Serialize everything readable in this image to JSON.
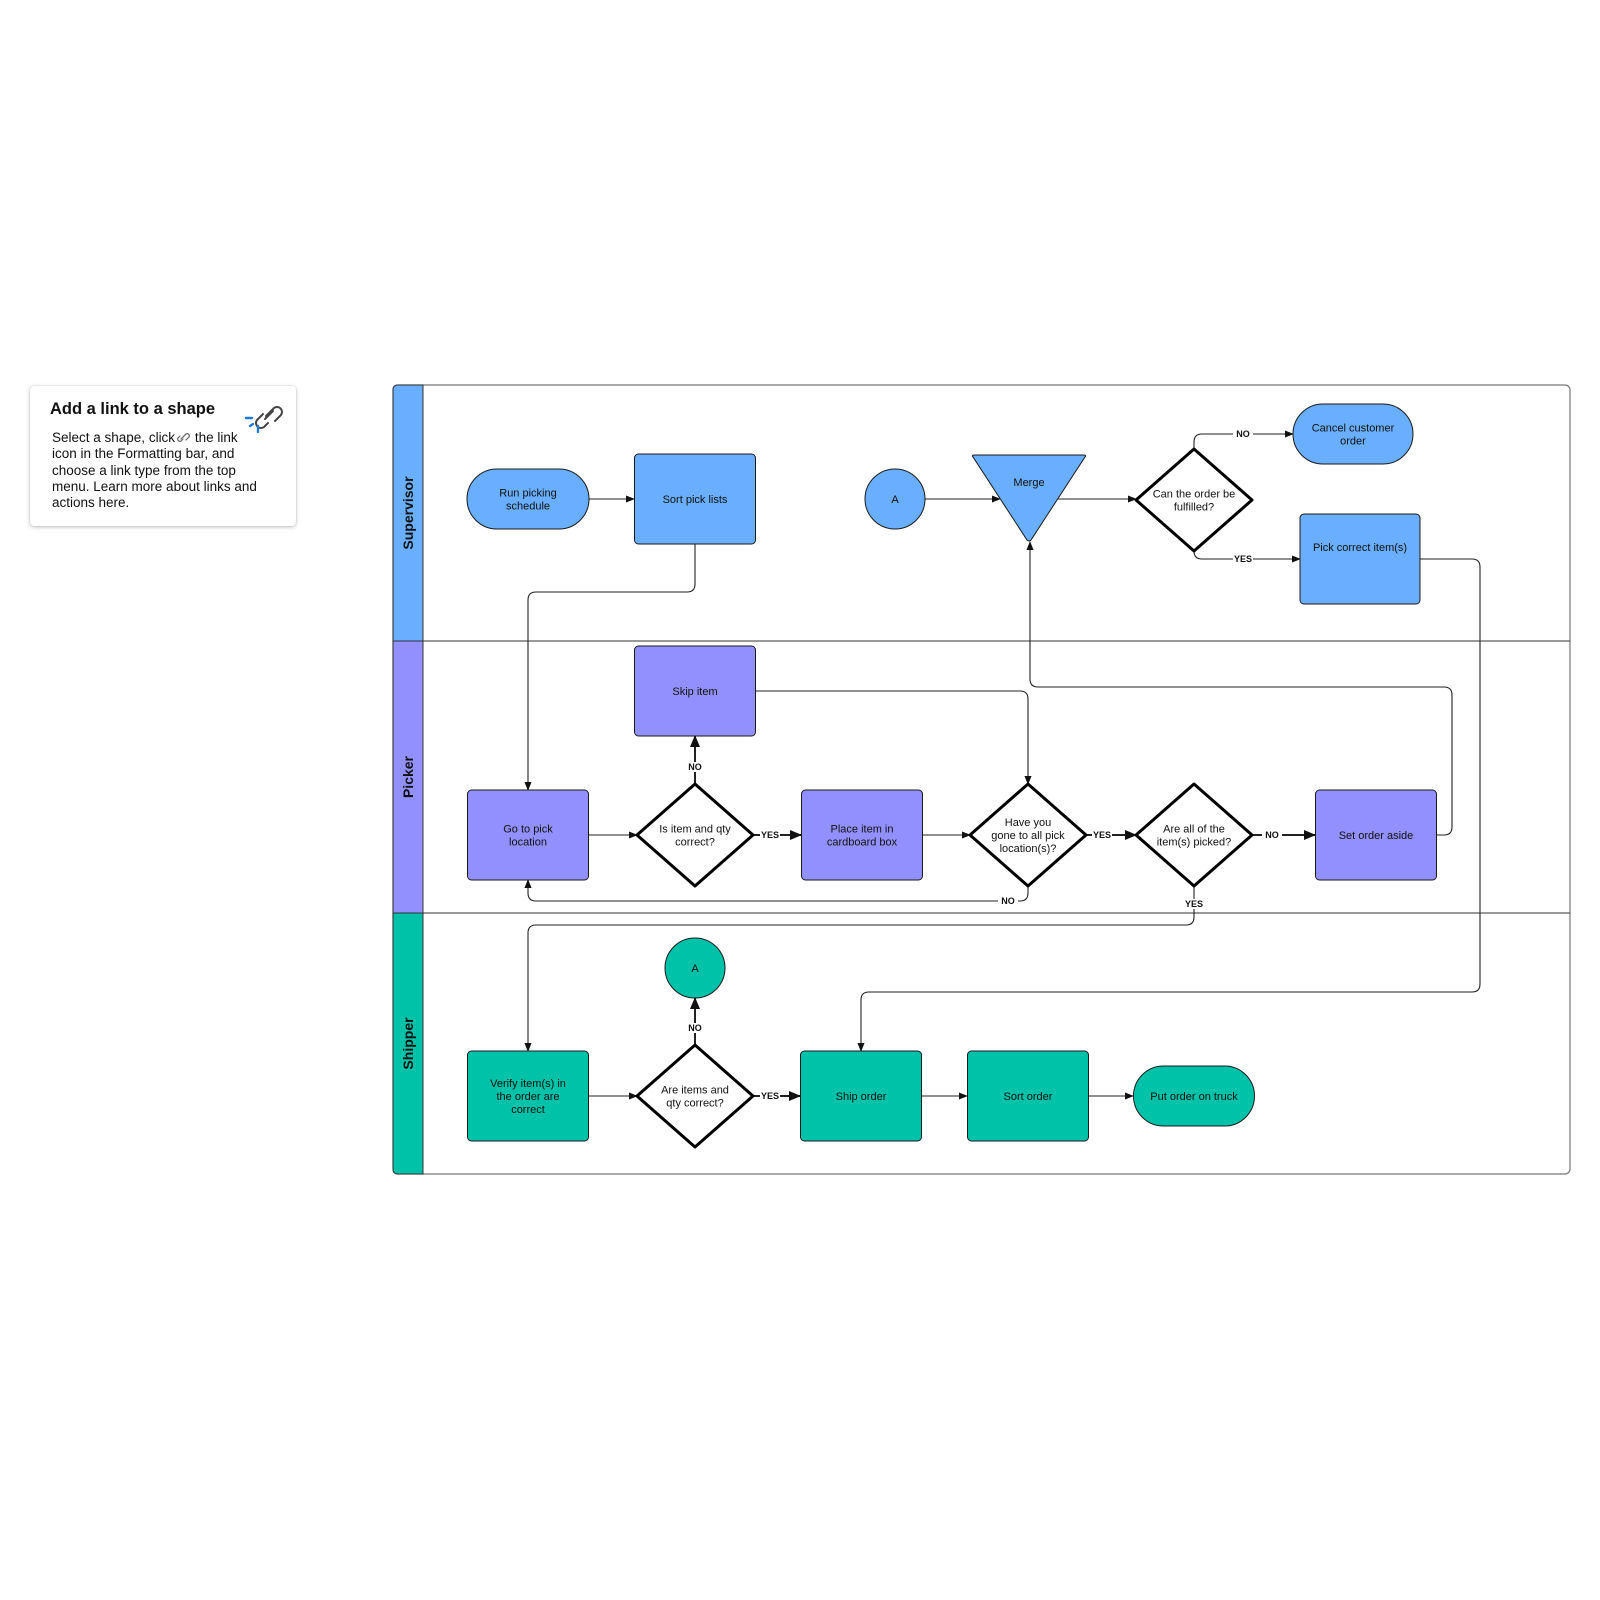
{
  "tip": {
    "title": "Add a link to a shape",
    "body_pre": "Select a shape, click",
    "body_post": " the link icon in the Formatting bar, and choose a link type from the top menu. Learn more about links and actions here.",
    "icon": "link-icon"
  },
  "colors": {
    "supervisor": "#6aaeff",
    "picker": "#9290ff",
    "shipper": "#00c2a8",
    "decision_fill": "#ffffff",
    "stroke": "#1a1a1a",
    "lane_border": "#555555"
  },
  "lanes": [
    {
      "id": "supervisor",
      "label": "Supervisor"
    },
    {
      "id": "picker",
      "label": "Picker"
    },
    {
      "id": "shipper",
      "label": "Shipper"
    }
  ],
  "nodes": {
    "run_picking": {
      "lane": "supervisor",
      "shape": "terminator",
      "lines": [
        "Run picking",
        "schedule"
      ]
    },
    "sort_pick_lists": {
      "lane": "supervisor",
      "shape": "process",
      "lines": [
        "Sort pick lists"
      ]
    },
    "connector_a_top": {
      "lane": "supervisor",
      "shape": "connector",
      "lines": [
        "A"
      ]
    },
    "merge": {
      "lane": "supervisor",
      "shape": "merge",
      "lines": [
        "Merge"
      ]
    },
    "can_fulfill": {
      "lane": "supervisor",
      "shape": "decision",
      "lines": [
        "Can the order be",
        "fulfilled?"
      ]
    },
    "cancel_order": {
      "lane": "supervisor",
      "shape": "terminator",
      "lines": [
        "Cancel customer",
        "order"
      ]
    },
    "pick_correct": {
      "lane": "supervisor",
      "shape": "process",
      "lines": [
        "Pick correct item(s)"
      ]
    },
    "skip_item": {
      "lane": "picker",
      "shape": "process",
      "lines": [
        "Skip item"
      ]
    },
    "go_to_pick": {
      "lane": "picker",
      "shape": "process",
      "lines": [
        "Go to pick",
        "location"
      ]
    },
    "item_qty_correct": {
      "lane": "picker",
      "shape": "decision",
      "lines": [
        "Is item and qty",
        "correct?"
      ]
    },
    "place_item": {
      "lane": "picker",
      "shape": "process",
      "lines": [
        "Place item in",
        "cardboard box"
      ]
    },
    "gone_all": {
      "lane": "picker",
      "shape": "decision",
      "lines": [
        "Have you",
        "gone to all pick",
        "location(s)?"
      ]
    },
    "all_picked": {
      "lane": "picker",
      "shape": "decision",
      "lines": [
        "Are all of the",
        "item(s) picked?"
      ]
    },
    "set_aside": {
      "lane": "picker",
      "shape": "process",
      "lines": [
        "Set order aside"
      ]
    },
    "verify_items": {
      "lane": "shipper",
      "shape": "process",
      "lines": [
        "Verify item(s) in",
        "the order are",
        "correct"
      ]
    },
    "connector_a_bottom": {
      "lane": "shipper",
      "shape": "connector",
      "lines": [
        "A"
      ]
    },
    "items_qty_correct": {
      "lane": "shipper",
      "shape": "decision",
      "lines": [
        "Are items and",
        "qty correct?"
      ]
    },
    "ship_order": {
      "lane": "shipper",
      "shape": "process",
      "lines": [
        "Ship order"
      ]
    },
    "sort_order": {
      "lane": "shipper",
      "shape": "process",
      "lines": [
        "Sort order"
      ]
    },
    "put_on_truck": {
      "lane": "shipper",
      "shape": "terminator",
      "lines": [
        "Put order on truck"
      ]
    }
  },
  "edges": [
    {
      "from": "run_picking",
      "to": "sort_pick_lists",
      "label": ""
    },
    {
      "from": "sort_pick_lists",
      "to": "go_to_pick",
      "label": ""
    },
    {
      "from": "connector_a_top",
      "to": "merge",
      "label": ""
    },
    {
      "from": "merge",
      "to": "can_fulfill",
      "label": ""
    },
    {
      "from": "can_fulfill",
      "to": "cancel_order",
      "label": "NO"
    },
    {
      "from": "can_fulfill",
      "to": "pick_correct",
      "label": "YES"
    },
    {
      "from": "pick_correct",
      "to": "ship_order",
      "label": ""
    },
    {
      "from": "go_to_pick",
      "to": "item_qty_correct",
      "label": ""
    },
    {
      "from": "item_qty_correct",
      "to": "skip_item",
      "label": "NO"
    },
    {
      "from": "item_qty_correct",
      "to": "place_item",
      "label": "YES"
    },
    {
      "from": "skip_item",
      "to": "gone_all",
      "label": ""
    },
    {
      "from": "place_item",
      "to": "gone_all",
      "label": ""
    },
    {
      "from": "gone_all",
      "to": "all_picked",
      "label": "YES"
    },
    {
      "from": "gone_all",
      "to": "go_to_pick",
      "label": "NO"
    },
    {
      "from": "all_picked",
      "to": "set_aside",
      "label": "NO"
    },
    {
      "from": "all_picked",
      "to": "verify_items",
      "label": "YES"
    },
    {
      "from": "set_aside",
      "to": "merge",
      "label": ""
    },
    {
      "from": "verify_items",
      "to": "items_qty_correct",
      "label": ""
    },
    {
      "from": "items_qty_correct",
      "to": "connector_a_bottom",
      "label": "NO"
    },
    {
      "from": "items_qty_correct",
      "to": "ship_order",
      "label": "YES"
    },
    {
      "from": "ship_order",
      "to": "sort_order",
      "label": ""
    },
    {
      "from": "sort_order",
      "to": "put_on_truck",
      "label": ""
    }
  ]
}
